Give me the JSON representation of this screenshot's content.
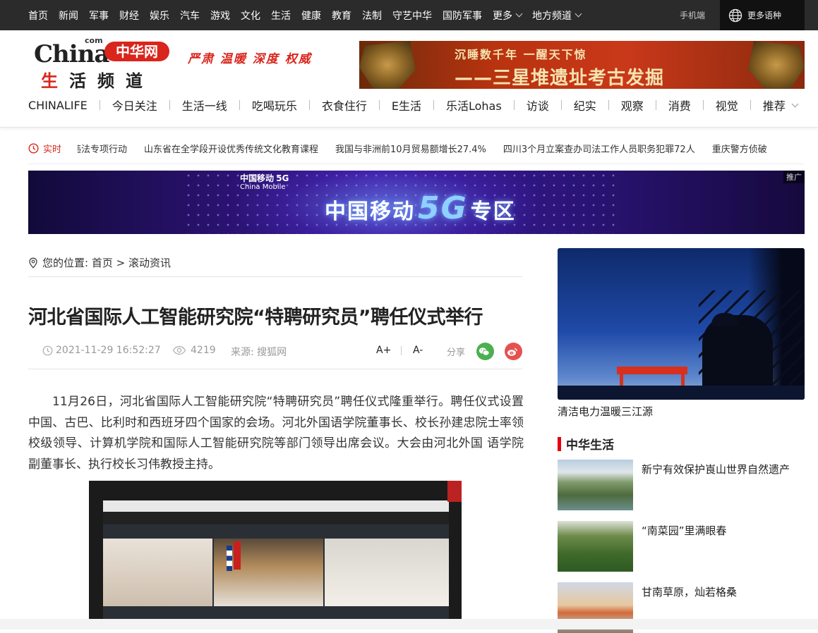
{
  "topnav": {
    "items": [
      "首页",
      "新闻",
      "军事",
      "财经",
      "娱乐",
      "汽车",
      "游戏",
      "文化",
      "生活",
      "健康",
      "教育",
      "法制",
      "守艺中华",
      "国防军事"
    ],
    "more": "更多",
    "local": "地方频道",
    "mobile": "手机端",
    "languages": "更多语种"
  },
  "header": {
    "logo_china": "China",
    "logo_com": "com",
    "logo_zh": "中华网",
    "logo_channel_red": "生",
    "logo_channel_rest": "活频道",
    "slogan": "严肃 温暖 深度 权威",
    "banner_line1": "沉睡数千年 一醒天下惊",
    "banner_line2": "——三星堆遗址考古发掘"
  },
  "channel_nav": {
    "items": [
      "CHINALIFE",
      "今日关注",
      "生活一线",
      "吃喝玩乐",
      "衣食住行",
      "E生活",
      "乐活Lohas",
      "访谈",
      "纪实",
      "观察",
      "消费",
      "视觉",
      "推荐"
    ]
  },
  "ticker": {
    "label": "实时",
    "items": [
      "违法专项行动",
      "山东省在全学段开设优秀传统文化教育课程",
      "我国与非洲前10月贸易额增长27.4%",
      "四川3个月立案查办司法工作人员职务犯罪72人",
      "重庆警方侦破"
    ]
  },
  "ad": {
    "brand_cn": "中国移动",
    "brand_en": "China Mobile",
    "brand_5g": "5G",
    "text_pre": "中国移动",
    "text_big": "5G",
    "text_post": "专区",
    "tag": "推广"
  },
  "breadcrumb": {
    "label": "您的位置:",
    "home": "首页",
    "sep": ">",
    "current": "滚动资讯"
  },
  "article": {
    "title": "河北省国际人工智能研究院“特聘研究员”聘任仪式举行",
    "datetime": "2021-11-29 16:52:27",
    "views": "4219",
    "source_label": "来源:",
    "source": "搜狐网",
    "font_up": "A+",
    "font_sep": "|",
    "font_down": "A-",
    "share": "分享",
    "body": "11月26日，河北省国际人工智能研究院“特聘研究员”聘任仪式隆重举行。聘任仪式设置中国、古巴、比利时和西班牙四个国家的会场。河北外国语学院董事长、校长孙建忠院士率领校级领导、计算机学院和国际人工智能研究院等部门领导出席会议。大会由河北外国 语学院副董事长、执行校长习伟教授主持。"
  },
  "sidebar": {
    "feature_caption": "清洁电力温暖三江源",
    "section_title": "中华生活",
    "list": [
      {
        "title": "新宁有效保护崀山世界自然遗产"
      },
      {
        "title": "“南菜园”里满眼春"
      },
      {
        "title": "甘南草原，灿若格桑"
      }
    ]
  },
  "colors": {
    "brand_red": "#d9251c",
    "topbar_bg": "#2b2b2b",
    "wechat_green": "#4caf50",
    "weibo_red": "#e5514f"
  }
}
